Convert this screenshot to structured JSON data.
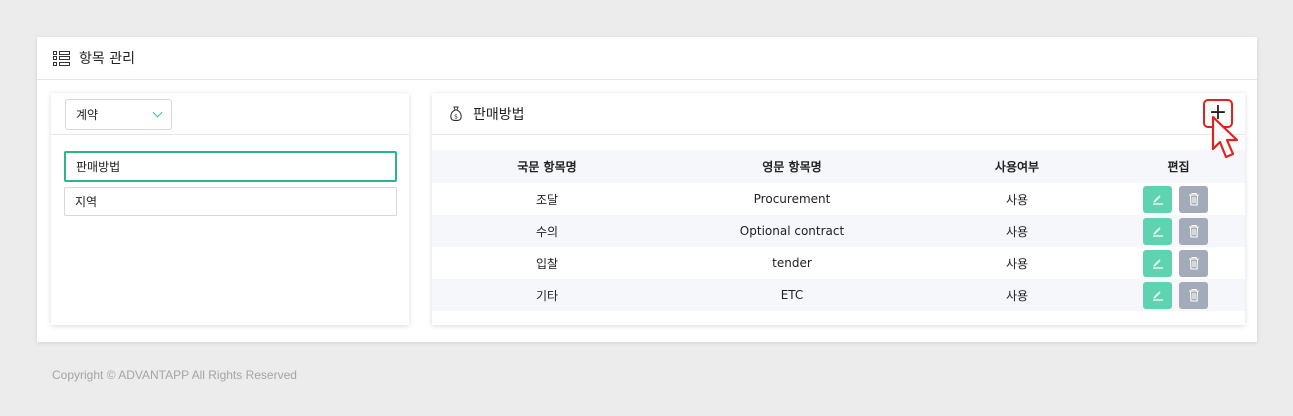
{
  "header": {
    "title": "항목 관리",
    "icon": "list-icon"
  },
  "left": {
    "select_value": "계약",
    "categories": [
      {
        "label": "판매방법",
        "active": true
      },
      {
        "label": "지역",
        "active": false
      }
    ]
  },
  "right": {
    "title": "판매방법",
    "title_icon": "money-bag-icon",
    "add_label": "+",
    "columns": [
      "국문 항목명",
      "영문 항목명",
      "사용여부",
      "편집"
    ],
    "rows": [
      {
        "kor": "조달",
        "eng": "Procurement",
        "use": "사용"
      },
      {
        "kor": "수의",
        "eng": "Optional contract",
        "use": "사용"
      },
      {
        "kor": "입찰",
        "eng": "tender",
        "use": "사용"
      },
      {
        "kor": "기타",
        "eng": "ETC",
        "use": "사용"
      }
    ]
  },
  "footer": {
    "copyright": "Copyright © ADVANTAPP All Rights Reserved"
  },
  "colors": {
    "accent": "#2bb58b",
    "edit": "#5fd3b0",
    "delete": "#a3aab8",
    "highlight": "#e0231e"
  }
}
